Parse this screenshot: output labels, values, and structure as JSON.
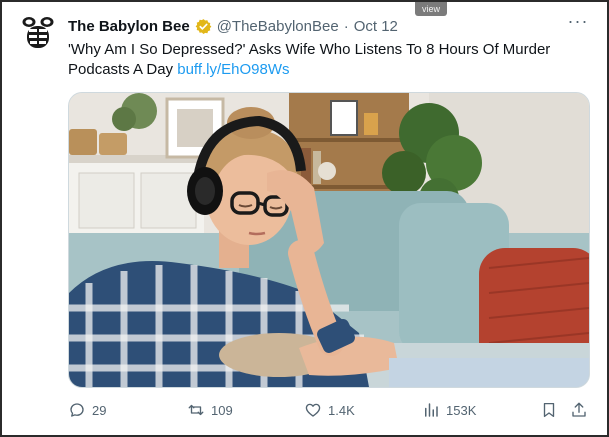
{
  "overlay": {
    "watermark": "view"
  },
  "tweet": {
    "author_name": "The Babylon Bee",
    "handle": "@TheBabylonBee",
    "separator": "·",
    "date": "Oct 12",
    "more_label": "···",
    "text": "'Why Am I So Depressed?' Asks Wife Who Listens To 8 Hours Of Murder Podcasts A Day",
    "link": "buff.ly/EhO98Ws",
    "verified_badge": "verified-badge-icon",
    "avatar_icon": "bee-logo-icon"
  },
  "media": {
    "subject": "photo-woman-headphones-couch"
  },
  "actions": {
    "replies": "29",
    "retweets": "109",
    "likes": "1.4K",
    "views": "153K"
  },
  "colors": {
    "text": "#0f1419",
    "secondary": "#536471",
    "link": "#1d9bf0",
    "verified": "#e2b719"
  }
}
